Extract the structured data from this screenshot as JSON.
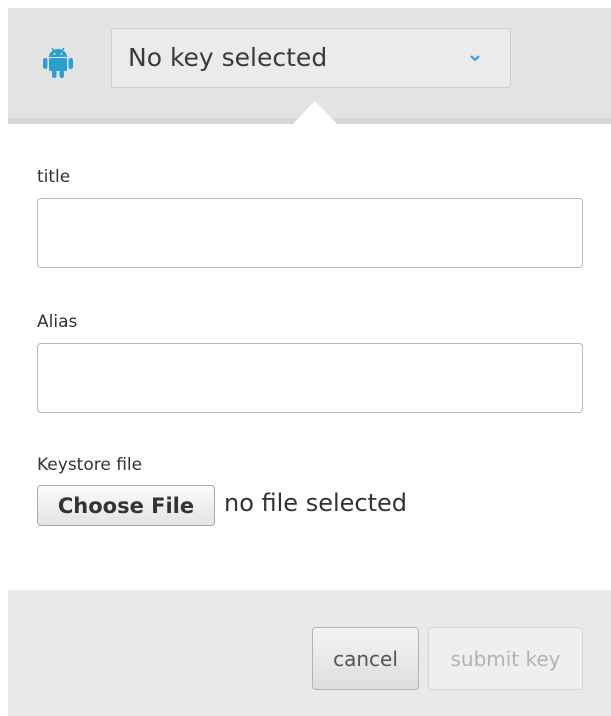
{
  "header": {
    "platform_icon": "android-icon",
    "key_select": {
      "value": "No key selected",
      "icon": "chevron-down-icon"
    }
  },
  "form": {
    "title_field": {
      "label": "title",
      "value": ""
    },
    "alias_field": {
      "label": "Alias",
      "value": ""
    },
    "keystore": {
      "label": "Keystore file",
      "button_label": "Choose File",
      "status": "no file selected"
    }
  },
  "footer": {
    "cancel_label": "cancel",
    "submit_label": "submit key"
  },
  "colors": {
    "android_icon": "#2b9fd0",
    "header_bg": "#e3e3e3",
    "footer_bg": "#e9e9e9",
    "disabled_text": "#b3b3b3"
  }
}
